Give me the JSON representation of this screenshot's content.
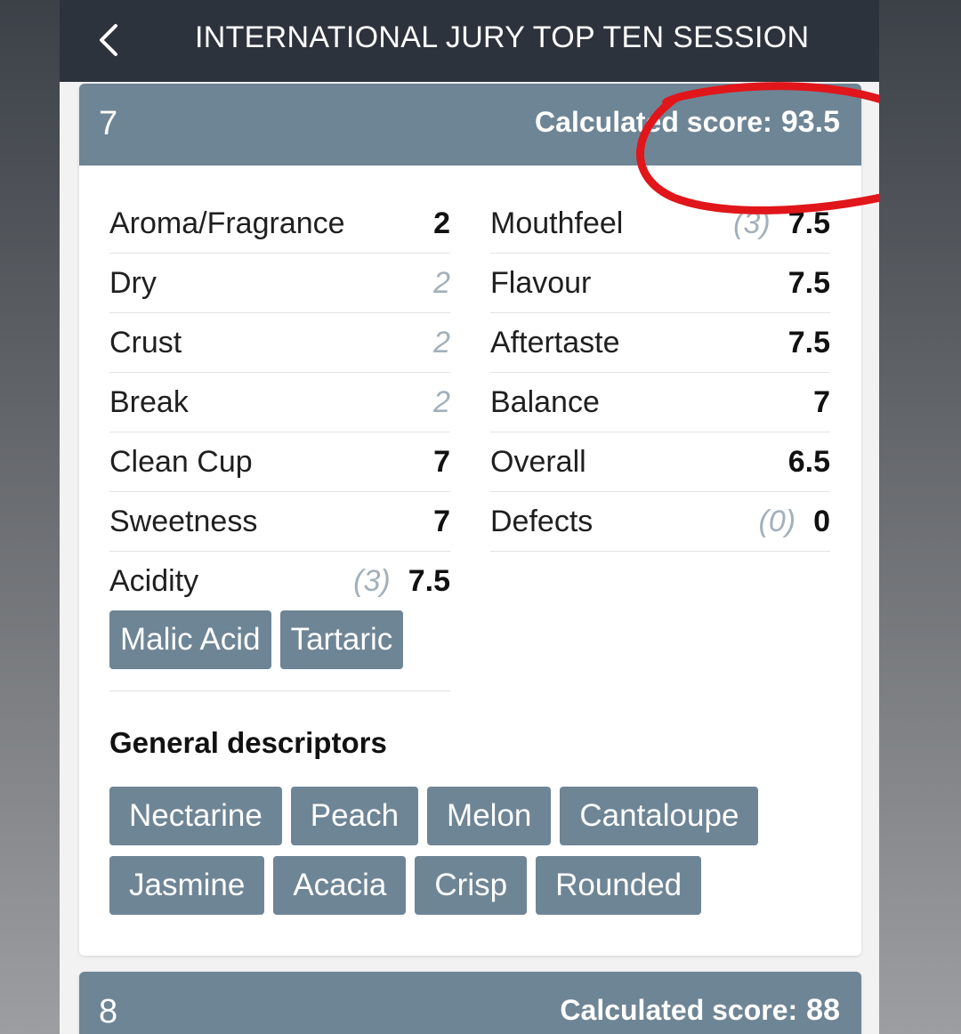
{
  "app_bar": {
    "title": "INTERNATIONAL JURY TOP TEN SESSION"
  },
  "score_label": "Calculated score:",
  "cards": [
    {
      "number": "7",
      "score": "93.5",
      "left": [
        {
          "label": "Aroma/Fragrance",
          "value": "2"
        },
        {
          "label": "Dry",
          "sub": "2"
        },
        {
          "label": "Crust",
          "sub": "2"
        },
        {
          "label": "Break",
          "sub": "2"
        },
        {
          "label": "Clean Cup",
          "value": "7"
        },
        {
          "label": "Sweetness",
          "value": "7"
        },
        {
          "label": "Acidity",
          "sub": "(3)",
          "value": "7.5"
        }
      ],
      "acidity_tags": [
        "Malic Acid",
        "Tartaric"
      ],
      "right": [
        {
          "label": "Mouthfeel",
          "sub": "(3)",
          "value": "7.5"
        },
        {
          "label": "Flavour",
          "value": "7.5"
        },
        {
          "label": "Aftertaste",
          "value": "7.5"
        },
        {
          "label": "Balance",
          "value": "7"
        },
        {
          "label": "Overall",
          "value": "6.5"
        },
        {
          "label": "Defects",
          "sub": "(0)",
          "value": "0"
        }
      ],
      "descriptors_title": "General descriptors",
      "descriptors": [
        "Nectarine",
        "Peach",
        "Melon",
        "Cantaloupe",
        "Jasmine",
        "Acacia",
        "Crisp",
        "Rounded"
      ]
    },
    {
      "number": "8",
      "score": "88"
    }
  ],
  "colors": {
    "app_bar": "#2d333d",
    "header": "#6e8596",
    "annotation": "#e0161b"
  }
}
